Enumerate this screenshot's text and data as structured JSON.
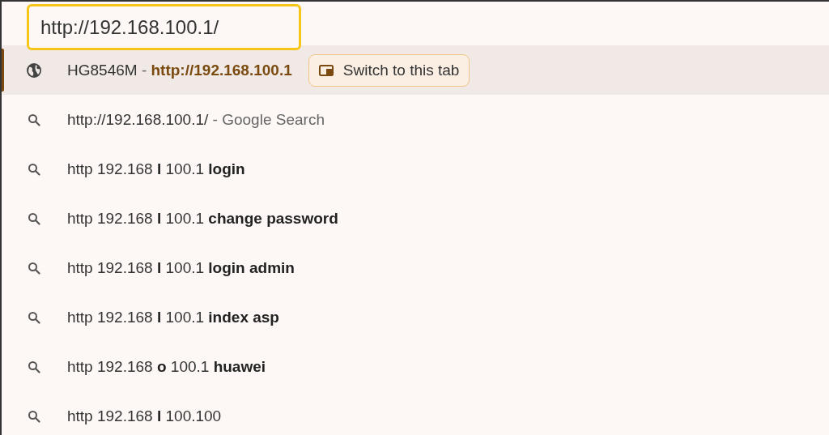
{
  "address_bar": {
    "value": "http://192.168.100.1/"
  },
  "suggestions": [
    {
      "kind": "tab",
      "title": "HG8546M",
      "separator": "-",
      "url": "http://192.168.100.1",
      "button": "Switch to this tab",
      "selected": true
    },
    {
      "kind": "search",
      "text": "http://192.168.100.1/",
      "suffix": "- Google Search",
      "selected": false
    },
    {
      "kind": "search",
      "text": "http 192.168 **l** 100.1 **login**",
      "selected": false
    },
    {
      "kind": "search",
      "text": "http 192.168 **l** 100.1 **change password**",
      "selected": false
    },
    {
      "kind": "search",
      "text": "http 192.168 **l** 100.1 **login admin**",
      "selected": false
    },
    {
      "kind": "search",
      "text": "http 192.168 **l** 100.1 **index asp**",
      "selected": false
    },
    {
      "kind": "search",
      "text": "http 192.168 **o** 100.1 **huawei**",
      "selected": false
    },
    {
      "kind": "search",
      "text": "http 192.168 **l** 100.100",
      "selected": false
    }
  ]
}
